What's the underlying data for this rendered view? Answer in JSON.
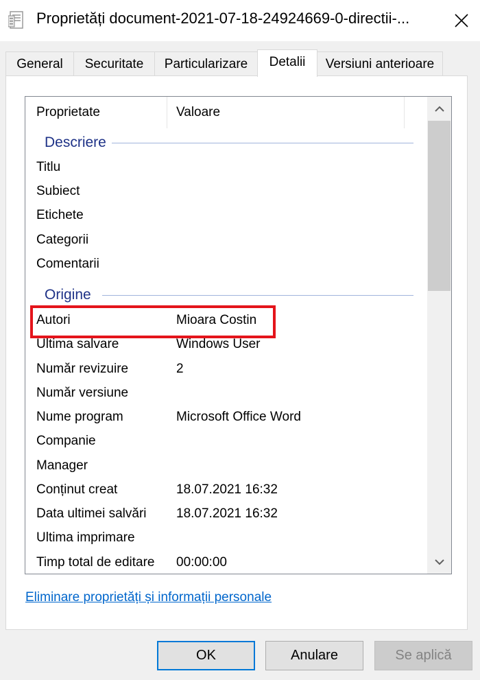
{
  "window": {
    "title": "Proprietăți document-2021-07-18-24924669-0-directii-...",
    "close_glyph": "✕"
  },
  "tabs": [
    {
      "label": "General",
      "active": false
    },
    {
      "label": "Securitate",
      "active": false
    },
    {
      "label": "Particularizare",
      "active": false
    },
    {
      "label": "Detalii",
      "active": true
    },
    {
      "label": "Versiuni anterioare",
      "active": false
    }
  ],
  "list": {
    "columns": {
      "property": "Proprietate",
      "value": "Valoare"
    },
    "groups": {
      "description": {
        "label": "Descriere",
        "rows": [
          {
            "key": "Titlu",
            "value": ""
          },
          {
            "key": "Subiect",
            "value": ""
          },
          {
            "key": "Etichete",
            "value": ""
          },
          {
            "key": "Categorii",
            "value": ""
          },
          {
            "key": "Comentarii",
            "value": ""
          }
        ]
      },
      "origin": {
        "label": "Origine",
        "rows": [
          {
            "key": "Autori",
            "value": "Mioara Costin"
          },
          {
            "key": "Ultima salvare",
            "value": "Windows User"
          },
          {
            "key": "Număr revizuire",
            "value": "2"
          },
          {
            "key": "Număr versiune",
            "value": ""
          },
          {
            "key": "Nume program",
            "value": "Microsoft Office Word"
          },
          {
            "key": "Companie",
            "value": ""
          },
          {
            "key": "Manager",
            "value": ""
          },
          {
            "key": "Conținut creat",
            "value": "18.07.2021 16:32"
          },
          {
            "key": "Data ultimei salvări",
            "value": "18.07.2021 16:32"
          },
          {
            "key": "Ultima imprimare",
            "value": ""
          },
          {
            "key": "Timp total de editare",
            "value": "00:00:00"
          }
        ]
      }
    },
    "highlight_color": "#e4141b"
  },
  "link": {
    "text": "Eliminare proprietăți și informații personale"
  },
  "buttons": {
    "ok": "OK",
    "cancel": "Anulare",
    "apply": "Se aplică"
  },
  "icons": {
    "title": "document-properties-icon",
    "scroll_up": "chevron-up-icon",
    "scroll_down": "chevron-down-icon"
  }
}
